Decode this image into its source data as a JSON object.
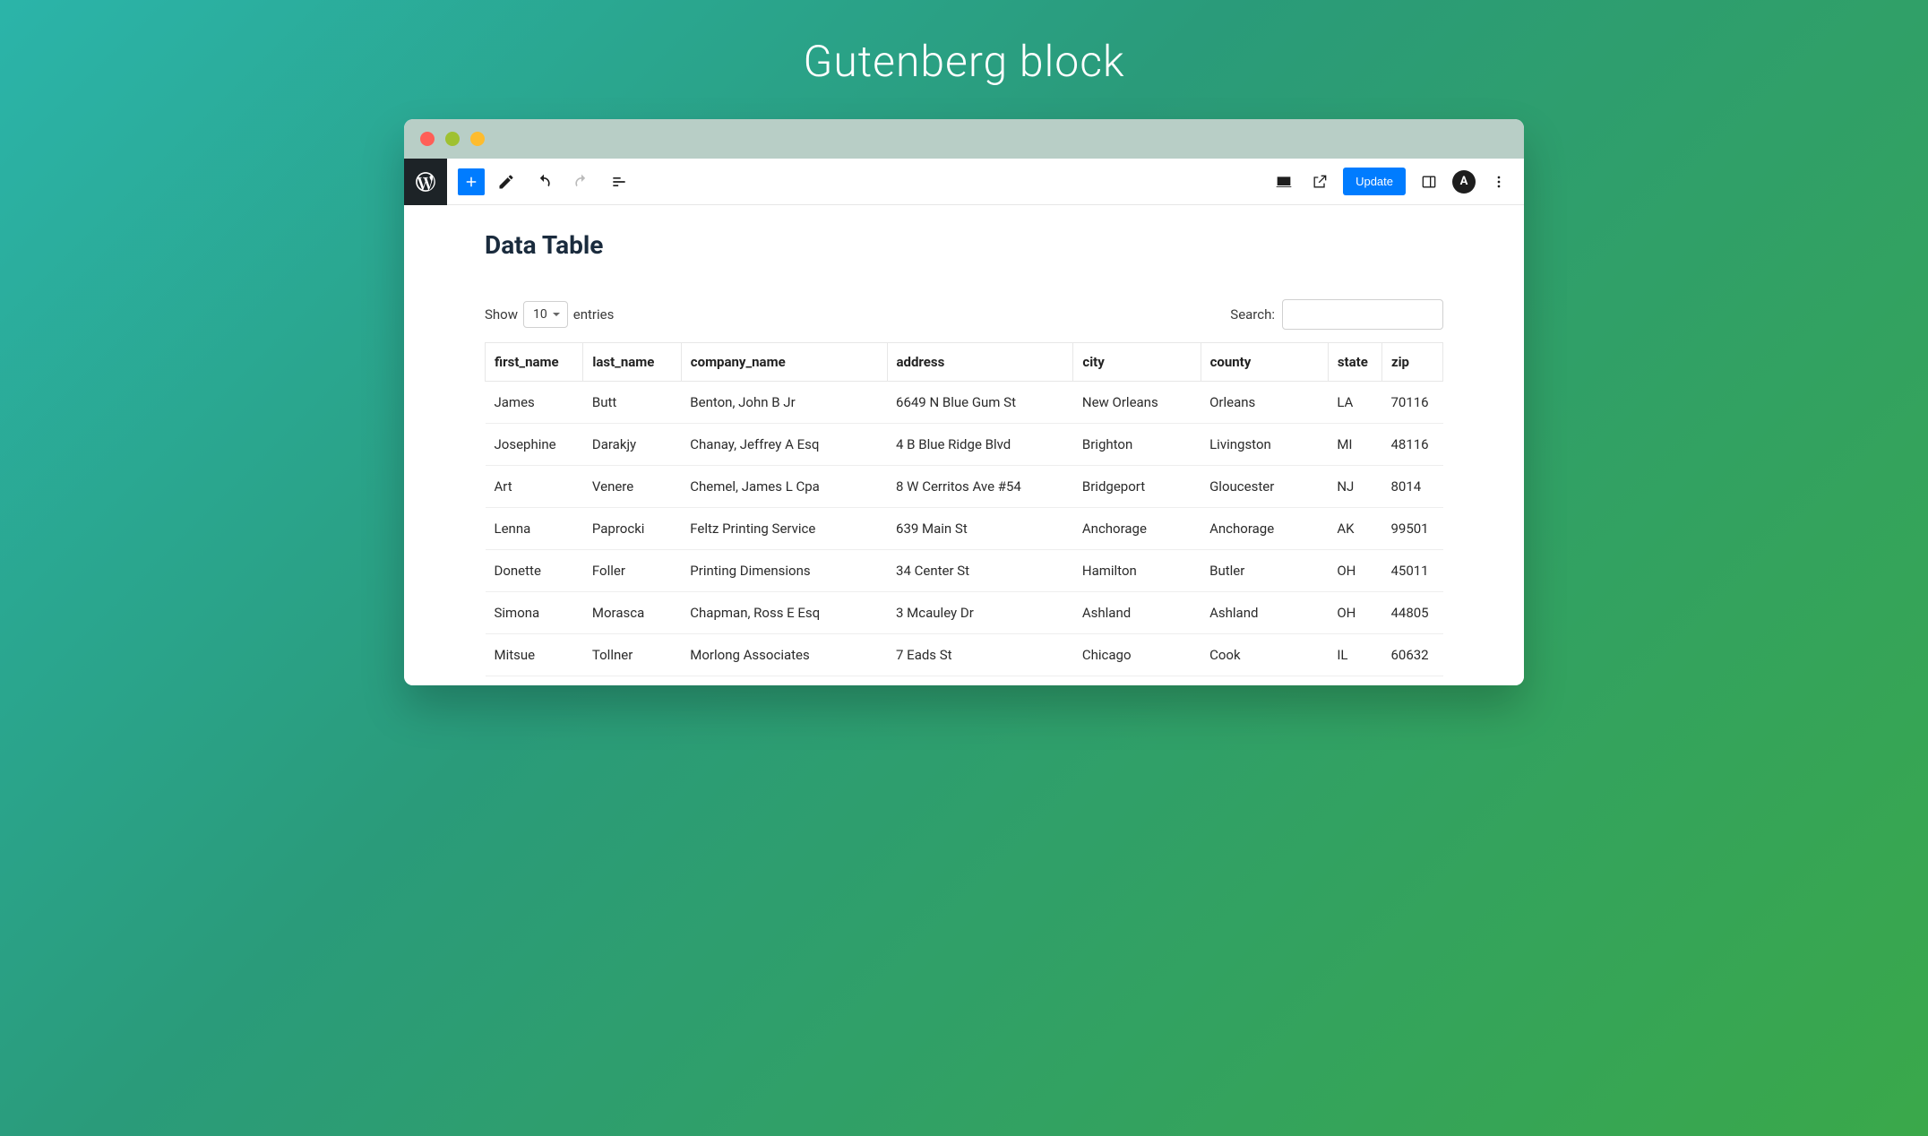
{
  "slide_title": "Gutenberg block",
  "toolbar": {
    "update_label": "Update",
    "avatar_initial": "A"
  },
  "block": {
    "heading": "Data Table"
  },
  "controls": {
    "show_label": "Show",
    "entries_label": "entries",
    "entries_value": "10",
    "search_label": "Search:",
    "search_value": ""
  },
  "columns": [
    "first_name",
    "last_name",
    "company_name",
    "address",
    "city",
    "county",
    "state",
    "zip"
  ],
  "rows": [
    {
      "first_name": "James",
      "last_name": "Butt",
      "company_name": "Benton, John B Jr",
      "address": "6649 N Blue Gum St",
      "city": "New Orleans",
      "county": "Orleans",
      "state": "LA",
      "zip": "70116"
    },
    {
      "first_name": "Josephine",
      "last_name": "Darakjy",
      "company_name": "Chanay, Jeffrey A Esq",
      "address": "4 B Blue Ridge Blvd",
      "city": "Brighton",
      "county": "Livingston",
      "state": "MI",
      "zip": "48116"
    },
    {
      "first_name": "Art",
      "last_name": "Venere",
      "company_name": "Chemel, James L Cpa",
      "address": "8 W Cerritos Ave #54",
      "city": "Bridgeport",
      "county": "Gloucester",
      "state": "NJ",
      "zip": "8014"
    },
    {
      "first_name": "Lenna",
      "last_name": "Paprocki",
      "company_name": "Feltz Printing Service",
      "address": "639 Main St",
      "city": "Anchorage",
      "county": "Anchorage",
      "state": "AK",
      "zip": "99501"
    },
    {
      "first_name": "Donette",
      "last_name": "Foller",
      "company_name": "Printing Dimensions",
      "address": "34 Center St",
      "city": "Hamilton",
      "county": "Butler",
      "state": "OH",
      "zip": "45011"
    },
    {
      "first_name": "Simona",
      "last_name": "Morasca",
      "company_name": "Chapman, Ross E Esq",
      "address": "3 Mcauley Dr",
      "city": "Ashland",
      "county": "Ashland",
      "state": "OH",
      "zip": "44805"
    },
    {
      "first_name": "Mitsue",
      "last_name": "Tollner",
      "company_name": "Morlong Associates",
      "address": "7 Eads St",
      "city": "Chicago",
      "county": "Cook",
      "state": "IL",
      "zip": "60632"
    }
  ]
}
